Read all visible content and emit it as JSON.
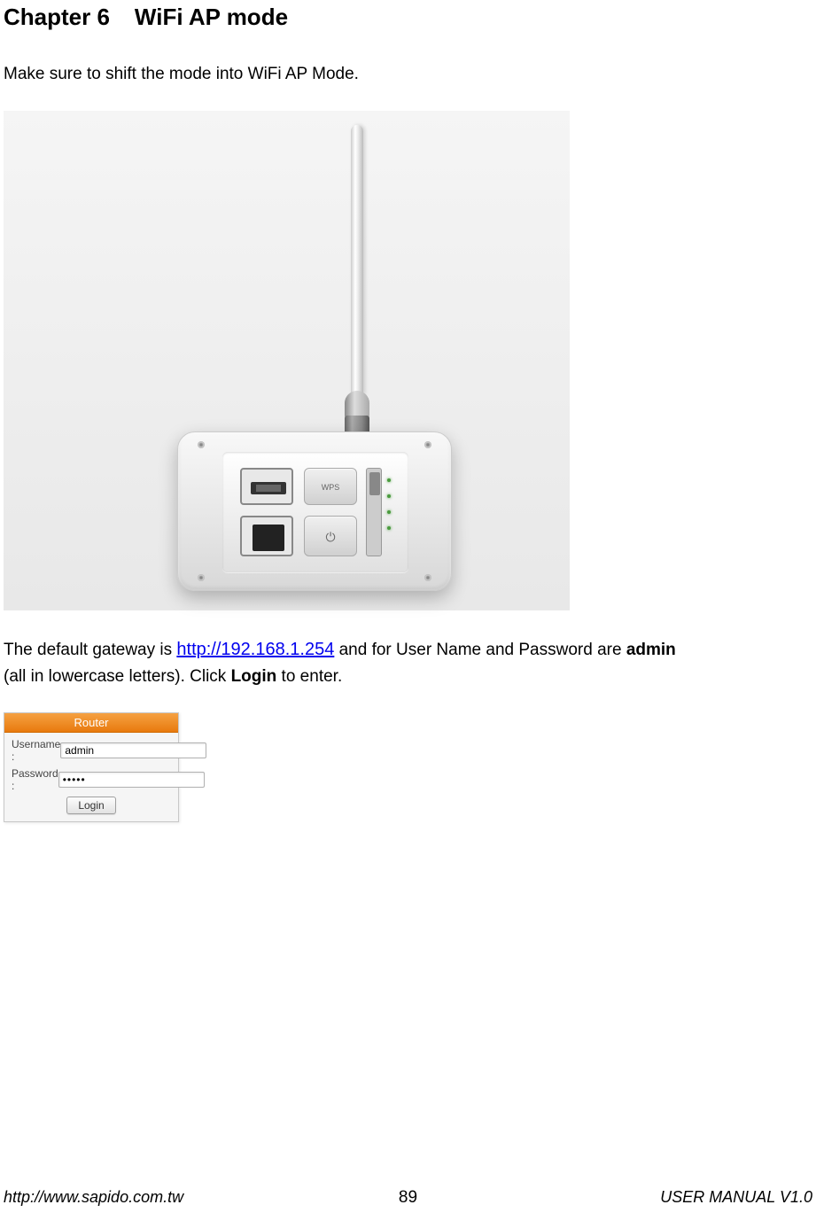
{
  "chapter": {
    "number": "Chapter 6",
    "title": "WiFi AP mode"
  },
  "intro": "Make sure to shift the mode into WiFi AP Mode.",
  "device": {
    "wps_label": "WPS",
    "power_symbol": "⏻"
  },
  "gateway": {
    "prefix": "The default gateway is ",
    "url": "http://192.168.1.254",
    "mid": " and for User Name and Password are ",
    "credentials": "admin",
    "line2_prefix": "(all in lowercase letters). Click ",
    "login_word": "Login",
    "line2_suffix": " to enter."
  },
  "login_panel": {
    "header": "Router",
    "username_label": "Username :",
    "username_value": "admin",
    "password_label": "Password :",
    "password_value": "•••••",
    "button_label": "Login"
  },
  "footer": {
    "url": "http://www.sapido.com.tw",
    "page": "89",
    "version": "USER MANUAL V1.0"
  }
}
